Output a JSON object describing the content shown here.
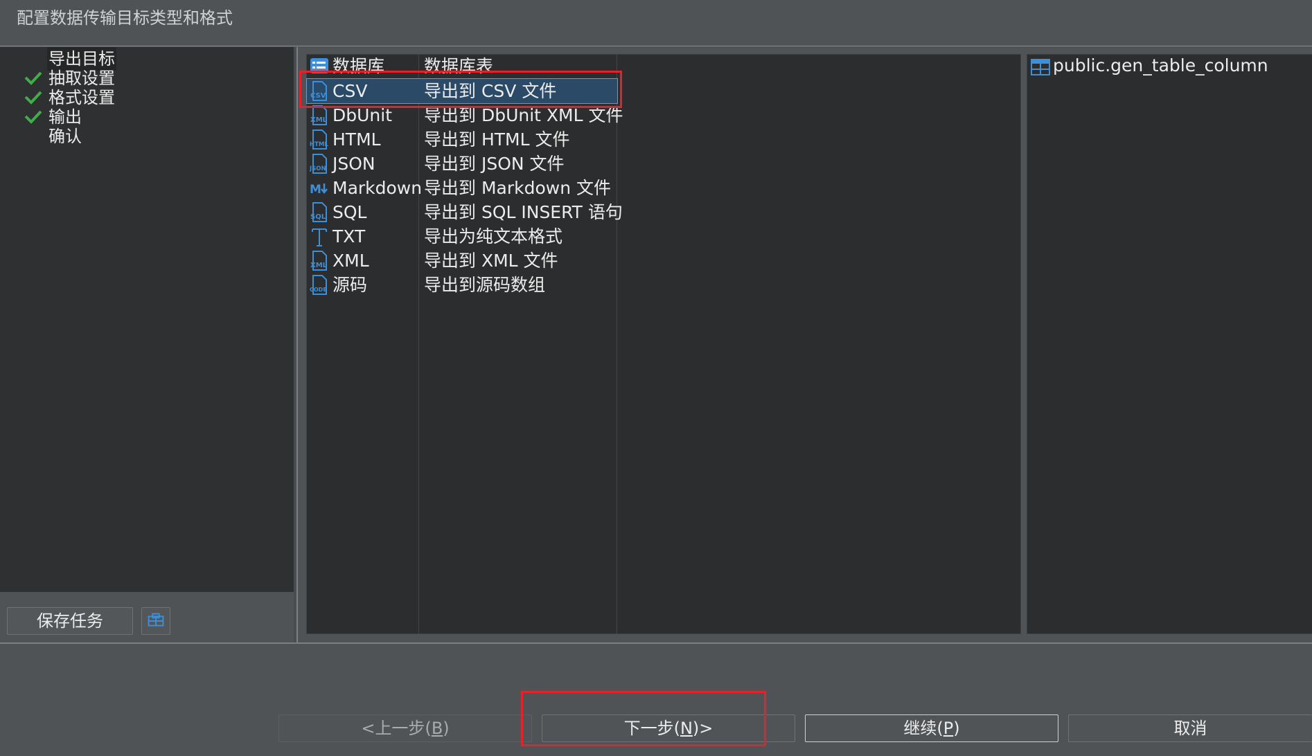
{
  "dialog": {
    "title": "配置数据传输目标类型和格式"
  },
  "steps": [
    {
      "label": "导出目标",
      "checked": false,
      "active": true
    },
    {
      "label": "抽取设置",
      "checked": true
    },
    {
      "label": "格式设置",
      "checked": true
    },
    {
      "label": "输出",
      "checked": true
    },
    {
      "label": "确认",
      "checked": false
    }
  ],
  "left_actions": {
    "save_label": "保存任务",
    "config_icon": "config-icon"
  },
  "formats": [
    {
      "name": "数据库",
      "desc": "数据库表",
      "icon": "database-icon"
    },
    {
      "name": "CSV",
      "desc": "导出到 CSV 文件",
      "icon": "csv-file-icon",
      "selected": true
    },
    {
      "name": "DbUnit",
      "desc": "导出到 DbUnit XML 文件",
      "icon": "xml-file-icon"
    },
    {
      "name": "HTML",
      "desc": "导出到 HTML 文件",
      "icon": "html-file-icon"
    },
    {
      "name": "JSON",
      "desc": "导出到 JSON 文件",
      "icon": "json-file-icon"
    },
    {
      "name": "Markdown",
      "desc": "导出到 Markdown 文件",
      "icon": "markdown-icon"
    },
    {
      "name": "SQL",
      "desc": "导出到 SQL INSERT 语句",
      "icon": "sql-file-icon"
    },
    {
      "name": "TXT",
      "desc": "导出为纯文本格式",
      "icon": "text-icon"
    },
    {
      "name": "XML",
      "desc": "导出到 XML 文件",
      "icon": "xml-file-icon"
    },
    {
      "name": "源码",
      "desc": "导出到源码数组",
      "icon": "code-file-icon"
    }
  ],
  "source_tables": [
    {
      "name": "public.gen_table_column",
      "icon": "table-icon"
    }
  ],
  "footer": {
    "prev_label_pre": "<上一步(",
    "prev_mnemonic": "B",
    "prev_label_post": ")",
    "next_label_pre": "下一步(",
    "next_mnemonic": "N",
    "next_label_post": ")>",
    "continue_label_pre": "继续(",
    "continue_mnemonic": "P",
    "continue_label_post": ")",
    "cancel_label": "取消"
  },
  "colors": {
    "highlight": "#e8202a",
    "check": "#3fae49",
    "selection": "#2b4a67",
    "icon_blue": "#3d8fd9"
  }
}
